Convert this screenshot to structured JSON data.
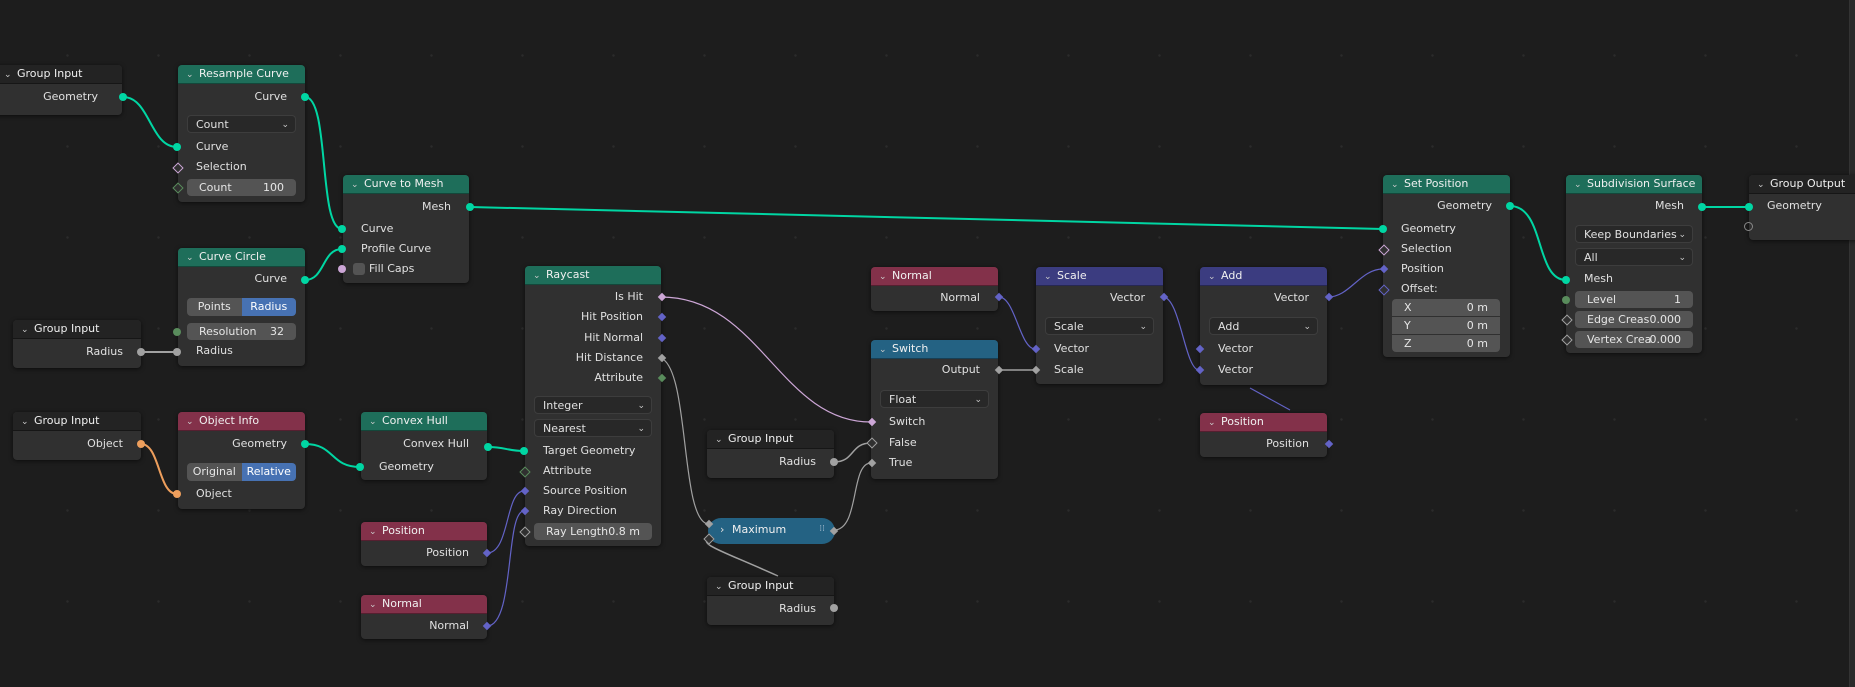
{
  "editor": "Geometry Node Editor",
  "colors": {
    "geometry_socket": "#00d6a3",
    "vector_socket": "#6363c7",
    "float_socket": "#a1a1a1",
    "boolean_socket": "#cca6d6",
    "integer_socket": "#598c5c",
    "object_socket": "#ed9e5c",
    "geometry_header": "#1e6e5a",
    "input_header": "#83314a",
    "vector_header": "#3b3c80",
    "converter_header": "#246283",
    "selected_toggle": "#4772b3"
  },
  "nodes": {
    "group_input_1": {
      "title": "Group Input",
      "outputs": [
        "Geometry"
      ]
    },
    "resample_curve": {
      "title": "Resample Curve",
      "outputs": [
        "Curve"
      ],
      "mode": "Count",
      "inputs": [
        "Curve",
        "Selection"
      ],
      "count_label": "Count",
      "count_value": "100"
    },
    "curve_to_mesh": {
      "title": "Curve to Mesh",
      "outputs": [
        "Mesh"
      ],
      "inputs": [
        "Curve",
        "Profile Curve",
        "Fill Caps"
      ]
    },
    "curve_circle": {
      "title": "Curve Circle",
      "outputs": [
        "Curve"
      ],
      "modes": [
        "Points",
        "Radius"
      ],
      "active_mode": "Radius",
      "resolution_label": "Resolution",
      "resolution_value": "32",
      "inputs": [
        "Radius"
      ]
    },
    "group_input_2": {
      "title": "Group Input",
      "outputs": [
        "Radius"
      ]
    },
    "group_input_3": {
      "title": "Group Input",
      "outputs": [
        "Object"
      ]
    },
    "object_info": {
      "title": "Object Info",
      "outputs": [
        "Geometry"
      ],
      "modes": [
        "Original",
        "Relative"
      ],
      "active_mode": "Relative",
      "inputs": [
        "Object"
      ]
    },
    "convex_hull": {
      "title": "Convex Hull",
      "outputs": [
        "Convex Hull"
      ],
      "inputs": [
        "Geometry"
      ]
    },
    "position_1": {
      "title": "Position",
      "outputs": [
        "Position"
      ]
    },
    "normal_1": {
      "title": "Normal",
      "outputs": [
        "Normal"
      ]
    },
    "raycast": {
      "title": "Raycast",
      "outputs": [
        "Is Hit",
        "Hit Position",
        "Hit Normal",
        "Hit Distance",
        "Attribute"
      ],
      "data_type": "Integer",
      "interpolation": "Nearest",
      "inputs": [
        "Target Geometry",
        "Attribute",
        "Source Position",
        "Ray Direction"
      ],
      "ray_length_label": "Ray Length",
      "ray_length_value": "0.8 m"
    },
    "group_input_4": {
      "title": "Group Input",
      "outputs": [
        "Radius"
      ]
    },
    "maximum": {
      "title": "Maximum"
    },
    "group_input_5": {
      "title": "Group Input",
      "outputs": [
        "Radius"
      ]
    },
    "normal_2": {
      "title": "Normal",
      "outputs": [
        "Normal"
      ]
    },
    "switch": {
      "title": "Switch",
      "outputs": [
        "Output"
      ],
      "data_type": "Float",
      "inputs": [
        "Switch",
        "False",
        "True"
      ]
    },
    "scale": {
      "title": "Scale",
      "outputs": [
        "Vector"
      ],
      "operation": "Scale",
      "inputs": [
        "Vector",
        "Scale"
      ]
    },
    "add": {
      "title": "Add",
      "outputs": [
        "Vector"
      ],
      "operation": "Add",
      "inputs": [
        "Vector",
        "Vector"
      ]
    },
    "position_2": {
      "title": "Position",
      "outputs": [
        "Position"
      ]
    },
    "set_position": {
      "title": "Set Position",
      "outputs": [
        "Geometry"
      ],
      "inputs": [
        "Geometry",
        "Selection",
        "Position",
        "Offset:"
      ],
      "offset": [
        {
          "axis": "X",
          "value": "0 m"
        },
        {
          "axis": "Y",
          "value": "0 m"
        },
        {
          "axis": "Z",
          "value": "0 m"
        }
      ]
    },
    "subdivision_surface": {
      "title": "Subdivision Surface",
      "outputs": [
        "Mesh"
      ],
      "boundary": "Keep Boundaries",
      "uv_smooth": "All",
      "inputs": [
        "Mesh"
      ],
      "level_label": "Level",
      "level_value": "1",
      "edge_crease_label": "Edge Creas",
      "edge_crease_value": "0.000",
      "vertex_crease_label": "Vertex Crea",
      "vertex_crease_value": "0.000"
    },
    "group_output": {
      "title": "Group Output",
      "inputs": [
        "Geometry"
      ]
    }
  }
}
